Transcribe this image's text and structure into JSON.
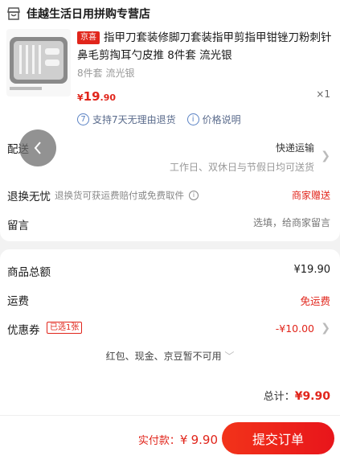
{
  "shop": {
    "name": "佳越生活日用拼购专营店",
    "icon": "shop-icon"
  },
  "product": {
    "tag": "京喜",
    "title": "指甲刀套装修脚刀套装指甲剪指甲钳锉刀粉刺针鼻毛剪掏耳勺皮推 8件套 流光银",
    "spec": "8件套 流光银",
    "price_symbol": "¥",
    "price_int": "19",
    "price_dec": ".90",
    "quantity": "×1",
    "services": [
      "支持7天无理由退货",
      "价格说明"
    ]
  },
  "delivery": {
    "label": "配送",
    "method": "快递运输",
    "schedule": "工作日、双休日与节假日均可送货"
  },
  "returns": {
    "label": "退换无忧",
    "desc": "退换货可获运费赔付或免费取件",
    "value": "商家赠送"
  },
  "note": {
    "label": "留言",
    "placeholder": "选填，给商家留言"
  },
  "summary": {
    "subtotal_label": "商品总额",
    "subtotal_value": "¥19.90",
    "shipping_label": "运费",
    "shipping_value": "免运费",
    "coupon_label": "优惠券",
    "coupon_tag": "已选1张",
    "coupon_value": "-¥10.00",
    "unavailable": "红包、现金、京豆暂不可用",
    "total_label": "总计：",
    "total_value": "¥9.90"
  },
  "footer": {
    "pay_label": "实付款：",
    "pay_symbol": "¥",
    "pay_value": "9.90",
    "submit": "提交订单"
  },
  "colors": {
    "accent": "#e1251b",
    "service_blue": "#5a82c4"
  }
}
